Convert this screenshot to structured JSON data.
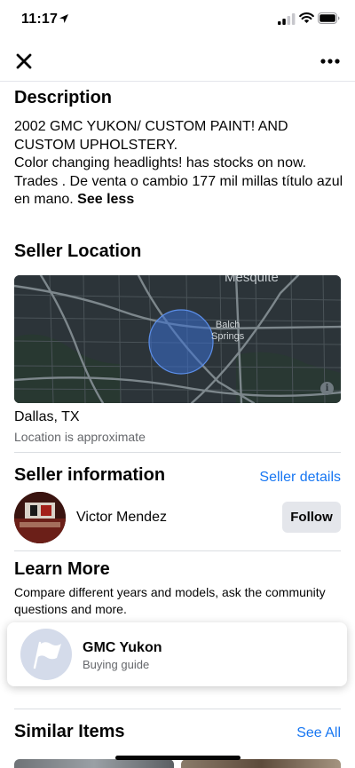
{
  "status_bar": {
    "time": "11:17",
    "icons": [
      "location-arrow-icon",
      "cellular-signal-icon",
      "wifi-icon",
      "battery-icon"
    ]
  },
  "nav": {
    "close_icon": "close-icon",
    "more_icon": "more-icon"
  },
  "description": {
    "title": "Description",
    "text": "2002 GMC YUKON/ CUSTOM PAINT! AND CUSTOM UPHOLSTERY.\nColor changing headlights! has stocks on now. Trades . De venta o cambio 177 mil millas título azul en mano.",
    "toggle_label": "See less"
  },
  "seller_location": {
    "title": "Seller Location",
    "map_labels": {
      "top": "Mesquite",
      "center": "Balch\nSprings"
    },
    "city": "Dallas, TX",
    "note": "Location is approximate"
  },
  "seller_info": {
    "title": "Seller information",
    "details_link": "Seller details",
    "name": "Victor Mendez",
    "follow_label": "Follow"
  },
  "learn_more": {
    "title": "Learn More",
    "text": "Compare different years and models, ask the community questions and more.",
    "guide": {
      "name": "GMC Yukon",
      "subtitle": "Buying guide",
      "icon": "flag-icon"
    }
  },
  "similar_items": {
    "title": "Similar Items",
    "see_all": "See All"
  },
  "colors": {
    "link": "#1877f2",
    "secondary_text": "#65676b",
    "button_bg": "#e4e6eb",
    "map_bg": "#2c3439",
    "map_radius": "#3b6fd1"
  }
}
